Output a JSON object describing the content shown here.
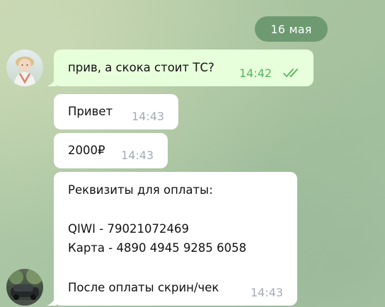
{
  "chat": {
    "date_separator": "16 мая",
    "colors": {
      "outgoing_bubble": "#e7ffdb",
      "incoming_bubble": "#ffffff",
      "date_pill": "#6e9a72",
      "read_ticks": "#58b45f"
    },
    "messages": [
      {
        "direction": "outgoing",
        "text": "прив, а скока стоит ТС?",
        "time": "14:42",
        "status_icon": "double-check-icon"
      },
      {
        "direction": "incoming",
        "text": "Привет",
        "time": "14:43"
      },
      {
        "direction": "incoming",
        "text": "2000₽",
        "time": "14:43"
      },
      {
        "direction": "incoming",
        "lines": [
          "Реквизиты для оплаты:",
          "",
          "QIWI - 79021072469",
          "Карта - 4890 4945 9285 6058",
          "",
          "После оплаты скрин/чек"
        ],
        "time": "14:43"
      }
    ],
    "avatars": {
      "outgoing_sender": "user-avatar",
      "incoming_sender": "contact-avatar"
    }
  }
}
